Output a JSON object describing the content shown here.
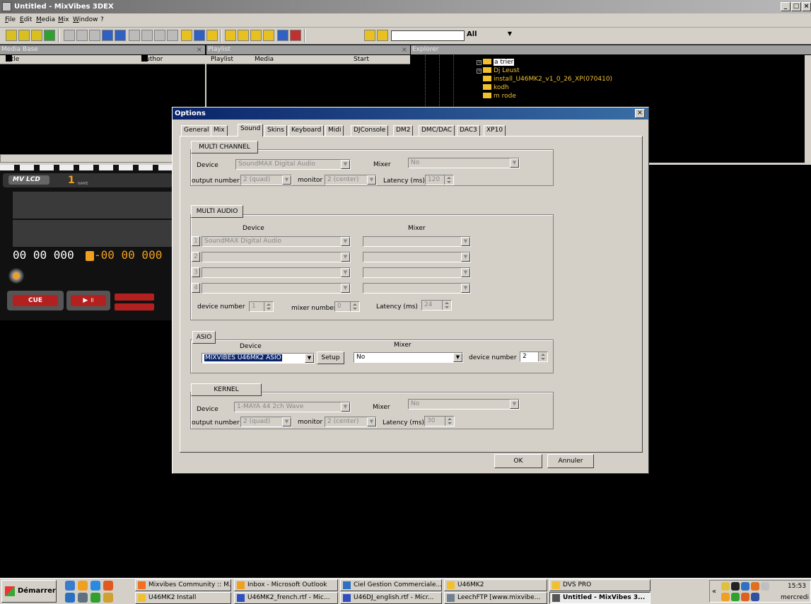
{
  "window": {
    "title": "Untitled - MixVibes 3DEX"
  },
  "menu": [
    "File",
    "Edit",
    "Media",
    "Mix",
    "Window",
    "?"
  ],
  "toolbar": {
    "search_value": "",
    "filter_value": "All"
  },
  "media_base": {
    "header": "Media Base",
    "columns": [
      "Title",
      "Author"
    ]
  },
  "playlist": {
    "header": "Playlist",
    "columns": [
      "Playlist",
      "Media",
      "Start"
    ]
  },
  "explorer": {
    "header": "Explorer",
    "items": [
      "a trier",
      "Dj Leust",
      "install_U46MK2_v1_0_26_XP(070410)",
      "kodh",
      "m rode"
    ]
  },
  "lcd": {
    "label": "MV LCD",
    "deck": "1",
    "name_label": "NAME",
    "time_left": "00 00 000",
    "time_right": "-00 00 000",
    "cue_label": "CUE"
  },
  "dialog": {
    "title": "Options",
    "tabs": [
      "General",
      "Mix",
      "Sound",
      "Skins",
      "Keyboard",
      "Midi",
      "DJConsole",
      "DM2",
      "DMC/DAC",
      "DAC3",
      "XP10"
    ],
    "active_tab": "Sound",
    "multi_channel": {
      "button": "MULTI CHANNEL",
      "device_label": "Device",
      "device_value": "SoundMAX Digital Audio",
      "mixer_label": "Mixer",
      "mixer_value": "No",
      "output_label": "output number",
      "output_value": "2 (quad)",
      "monitor_label": "monitor",
      "monitor_value": "2 (center)",
      "latency_label": "Latency (ms)",
      "latency_value": "120"
    },
    "multi_audio": {
      "button": "MULTI AUDIO",
      "device_header": "Device",
      "mixer_header": "Mixer",
      "rows": [
        {
          "num": "1",
          "device": "SoundMAX Digital Audio",
          "mixer": ""
        },
        {
          "num": "2",
          "device": "",
          "mixer": ""
        },
        {
          "num": "3",
          "device": "",
          "mixer": ""
        },
        {
          "num": "4",
          "device": "",
          "mixer": ""
        }
      ],
      "device_number_label": "device number",
      "device_number_value": "1",
      "mixer_number_label": "mixer number",
      "mixer_number_value": "0",
      "latency_label": "Latency (ms)",
      "latency_value": "24"
    },
    "asio": {
      "button": "ASIO",
      "device_header": "Device",
      "mixer_header": "Mixer",
      "device_value": "MIXVIBES U46MK2 ASIO",
      "setup_label": "Setup",
      "mixer_value": "No",
      "device_number_label": "device number",
      "device_number_value": "2"
    },
    "kernel": {
      "button": "KERNEL",
      "device_label": "Device",
      "device_value": "1-MAYA 44 2ch Wave",
      "mixer_label": "Mixer",
      "mixer_value": "No",
      "output_label": "output number",
      "output_value": "2 (quad)",
      "monitor_label": "monitor",
      "monitor_value": "2 (center)",
      "latency_label": "Latency (ms)",
      "latency_value": "30"
    },
    "ok_label": "OK",
    "cancel_label": "Annuler"
  },
  "taskbar": {
    "start_label": "Démarrer",
    "tasks_row1": [
      "Mixvibes Community :: M...",
      "Inbox - Microsoft Outlook",
      "Ciel Gestion Commerciale...",
      "U46MK2",
      "DVS PRO"
    ],
    "tasks_row2": [
      "U46MK2 Install",
      "U46MK2_french.rtf - Mic...",
      "U46DJ_english.rtf - Micr...",
      "LeechFTP [www.mixvibe...",
      "Untitled - MixVibes 3..."
    ],
    "clock": "15:53",
    "day": "mercredi"
  },
  "colors": {
    "dialog_title_start": "#0a246a",
    "dialog_title_end": "#3a6ea5",
    "lcd_accent": "#f0a020",
    "lcd_text": "#ffffff"
  }
}
